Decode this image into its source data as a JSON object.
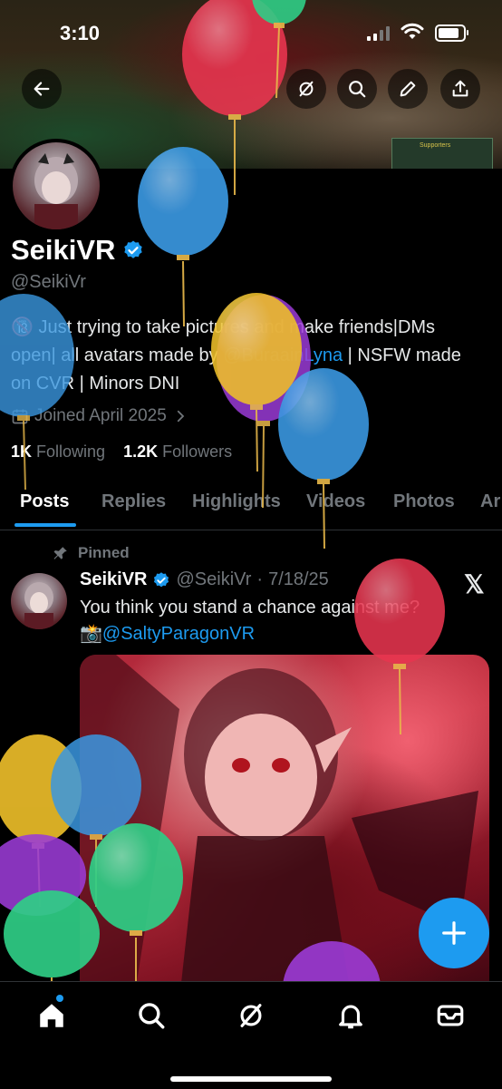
{
  "status_bar": {
    "time": "3:10"
  },
  "header": {
    "back_icon": "arrow-left-icon",
    "actions": [
      "grok-icon",
      "search-icon",
      "edit-icon",
      "share-icon"
    ]
  },
  "banner": {
    "sign_text": "Supporters"
  },
  "profile": {
    "display_name": "SeikiVR",
    "handle": "@SeikiVr",
    "bio_part1": "🔞 Just trying to take pictures and make friends|DMs open| all avatars made by ",
    "bio_link": "@BuraainLyna",
    "bio_part2": " | NSFW made on CVR | Minors DNI",
    "joined": "Joined April 2025",
    "following_count": "1K",
    "following_label": "Following",
    "followers_count": "1.2K",
    "followers_label": "Followers"
  },
  "tabs": [
    "Posts",
    "Replies",
    "Highlights",
    "Videos",
    "Photos",
    "Ar"
  ],
  "post": {
    "pinned_label": "Pinned",
    "author_name": "SeikiVR",
    "author_handle": "@SeikiVr",
    "separator": "·",
    "date": "7/18/25",
    "text": "You think you stand a chance against me?",
    "camera_emoji": "📸",
    "mention": "@SaltyParagonVR"
  },
  "fab": {
    "icon": "plus-icon"
  },
  "bottom_nav": [
    "home-icon",
    "search-icon",
    "grok-icon",
    "bell-icon",
    "mail-icon"
  ],
  "colors": {
    "accent": "#1d9bf0",
    "balloon_red": "#e8354f",
    "balloon_blue": "#3a97e0",
    "balloon_yellow": "#efc02a",
    "balloon_purple": "#9b3bd6",
    "balloon_green": "#2fce86"
  }
}
